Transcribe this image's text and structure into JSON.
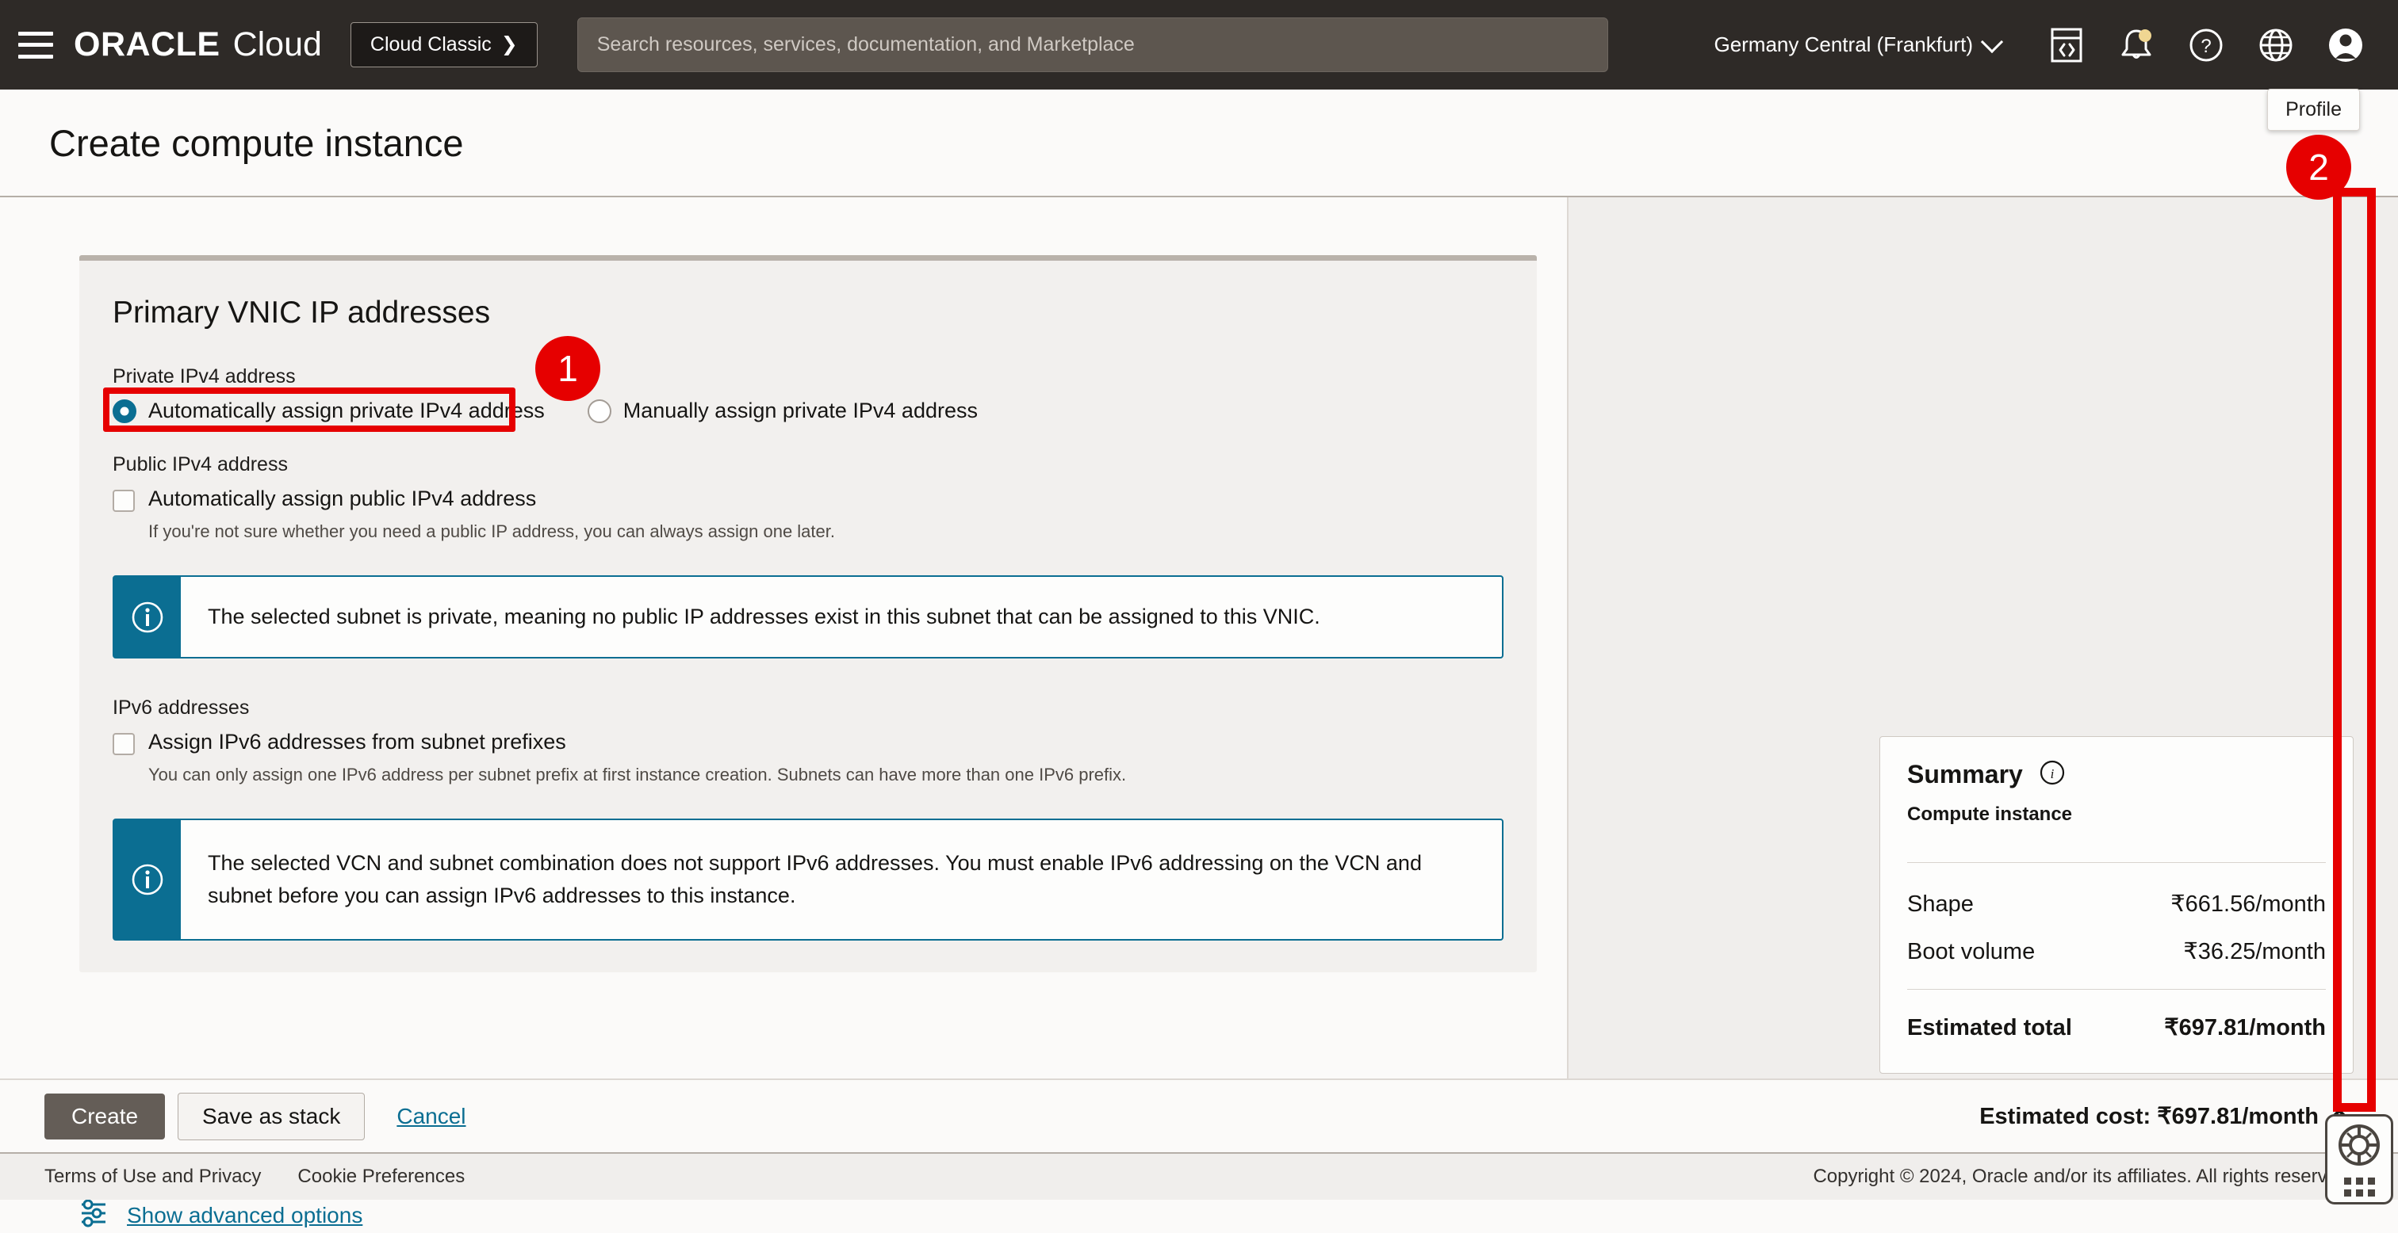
{
  "topbar": {
    "menu_icon": "hamburger-icon",
    "brand_oracle": "ORACLE",
    "brand_cloud": "Cloud",
    "classic_button": "Cloud Classic",
    "classic_chevron": "❯",
    "search": {
      "placeholder": "Search resources, services, documentation, and Marketplace",
      "value": ""
    },
    "region": "Germany Central (Frankfurt)",
    "icons": [
      "code-editor-icon",
      "notifications-bell-icon",
      "help-question-icon",
      "globe-language-icon",
      "profile-avatar-icon"
    ],
    "tooltip": "Profile"
  },
  "page": {
    "title": "Create compute instance"
  },
  "form": {
    "card_title": "Primary VNIC IP addresses",
    "private_ipv4": {
      "label": "Private IPv4 address",
      "options": [
        {
          "label": "Automatically assign private IPv4 address",
          "selected": true
        },
        {
          "label": "Manually assign private IPv4 address",
          "selected": false
        }
      ]
    },
    "public_ipv4": {
      "label": "Public IPv4 address",
      "checkbox_label": "Automatically assign public IPv4 address",
      "checked": false,
      "help": "If you're not sure whether you need a public IP address, you can always assign one later.",
      "banner": "The selected subnet is private, meaning no public IP addresses exist in this subnet that can be assigned to this VNIC."
    },
    "ipv6": {
      "label": "IPv6 addresses",
      "checkbox_label": "Assign IPv6 addresses from subnet prefixes",
      "checked": false,
      "help": "You can only assign one IPv6 address per subnet prefix at first instance creation. Subnets can have more than one IPv6 prefix.",
      "banner": "The selected VCN and subnet combination does not support IPv6 addresses. You must enable IPv6 addressing on the VCN and subnet before you can assign IPv6 addresses to this instance."
    },
    "advanced_link": "Show advanced options",
    "advanced_icon": "sliders-settings-icon"
  },
  "summary": {
    "title": "Summary",
    "info_icon": "info-circle-icon",
    "subtitle": "Compute instance",
    "rows": [
      {
        "label": "Shape",
        "value": "₹661.56/month"
      },
      {
        "label": "Boot volume",
        "value": "₹36.25/month"
      }
    ],
    "total_label": "Estimated total",
    "total_value": "₹697.81/month"
  },
  "help_widget": {
    "icon": "life-preserver-icon",
    "handle": "grip-dots-handle"
  },
  "actions": {
    "create": "Create",
    "save_as_stack": "Save as stack",
    "cancel": "Cancel",
    "estimated_cost": "Estimated cost: ₹697.81/month",
    "collapse_icon": "chevron-up-icon"
  },
  "footer": {
    "terms": "Terms of Use and Privacy",
    "cookies": "Cookie Preferences",
    "copyright": "Copyright © 2024, Oracle and/or its affiliates. All rights reserved."
  },
  "annotations": {
    "color": "#E60000",
    "markers": [
      {
        "number": "1",
        "target": "automatically-assign-private-ipv4-radio"
      },
      {
        "number": "2",
        "target": "page-scrollbar"
      }
    ]
  }
}
